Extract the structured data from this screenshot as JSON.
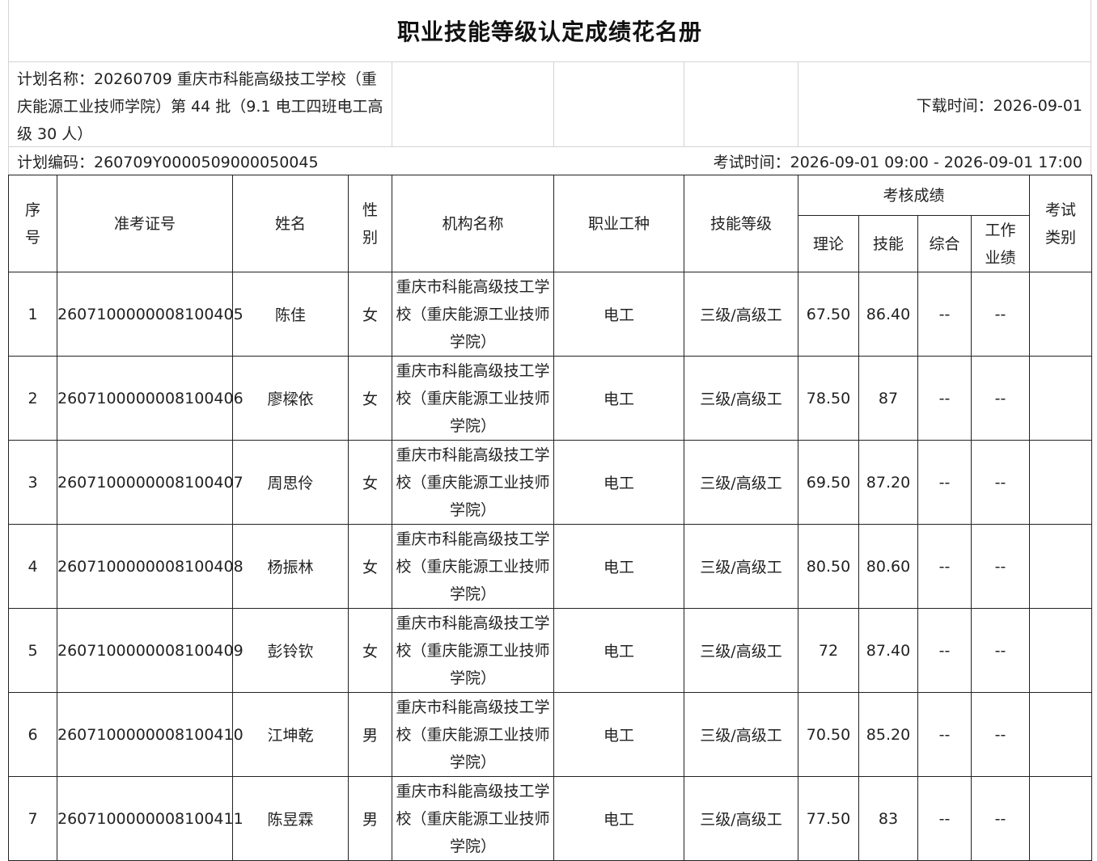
{
  "title": "职业技能等级认定成绩花名册",
  "plan": {
    "name": "计划名称：20260709 重庆市科能高级技工学校（重庆能源工业技师学院）第 44 批（9.1 电工四班电工高级 30 人）",
    "download_time": "下载时间：2026-09-01",
    "code": "计划编码：260709Y0000509000050045",
    "exam_time": "考试时间：2026-09-01 09:00 - 2026-09-01 17:00"
  },
  "headers": {
    "seq": "序号",
    "ticket": "准考证号",
    "name": "姓名",
    "gender": "性别",
    "institution": "机构名称",
    "occupation": "职业工种",
    "level": "技能等级",
    "scores": "考核成绩",
    "theory": "理论",
    "skill": "技能",
    "comprehensive": "综合",
    "work": "工作业绩",
    "exam_type": "考试类别"
  },
  "rows": [
    {
      "seq": "1",
      "ticket": "2607100000008100405",
      "name": "陈佳",
      "gender": "女",
      "institution": "重庆市科能高级技工学校（重庆能源工业技师学院）",
      "occupation": "电工",
      "level": "三级/高级工",
      "theory": "67.50",
      "skill": "86.40",
      "comprehensive": "--",
      "work": "--",
      "exam_type": ""
    },
    {
      "seq": "2",
      "ticket": "2607100000008100406",
      "name": "廖樑依",
      "gender": "女",
      "institution": "重庆市科能高级技工学校（重庆能源工业技师学院）",
      "occupation": "电工",
      "level": "三级/高级工",
      "theory": "78.50",
      "skill": "87",
      "comprehensive": "--",
      "work": "--",
      "exam_type": ""
    },
    {
      "seq": "3",
      "ticket": "2607100000008100407",
      "name": "周思伶",
      "gender": "女",
      "institution": "重庆市科能高级技工学校（重庆能源工业技师学院）",
      "occupation": "电工",
      "level": "三级/高级工",
      "theory": "69.50",
      "skill": "87.20",
      "comprehensive": "--",
      "work": "--",
      "exam_type": ""
    },
    {
      "seq": "4",
      "ticket": "2607100000008100408",
      "name": "杨振林",
      "gender": "女",
      "institution": "重庆市科能高级技工学校（重庆能源工业技师学院）",
      "occupation": "电工",
      "level": "三级/高级工",
      "theory": "80.50",
      "skill": "80.60",
      "comprehensive": "--",
      "work": "--",
      "exam_type": ""
    },
    {
      "seq": "5",
      "ticket": "2607100000008100409",
      "name": "彭铃钦",
      "gender": "女",
      "institution": "重庆市科能高级技工学校（重庆能源工业技师学院）",
      "occupation": "电工",
      "level": "三级/高级工",
      "theory": "72",
      "skill": "87.40",
      "comprehensive": "--",
      "work": "--",
      "exam_type": ""
    },
    {
      "seq": "6",
      "ticket": "2607100000008100410",
      "name": "江坤乾",
      "gender": "男",
      "institution": "重庆市科能高级技工学校（重庆能源工业技师学院）",
      "occupation": "电工",
      "level": "三级/高级工",
      "theory": "70.50",
      "skill": "85.20",
      "comprehensive": "--",
      "work": "--",
      "exam_type": ""
    },
    {
      "seq": "7",
      "ticket": "2607100000008100411",
      "name": "陈昱霖",
      "gender": "男",
      "institution": "重庆市科能高级技工学校（重庆能源工业技师学院）",
      "occupation": "电工",
      "level": "三级/高级工",
      "theory": "77.50",
      "skill": "83",
      "comprehensive": "--",
      "work": "--",
      "exam_type": ""
    }
  ]
}
